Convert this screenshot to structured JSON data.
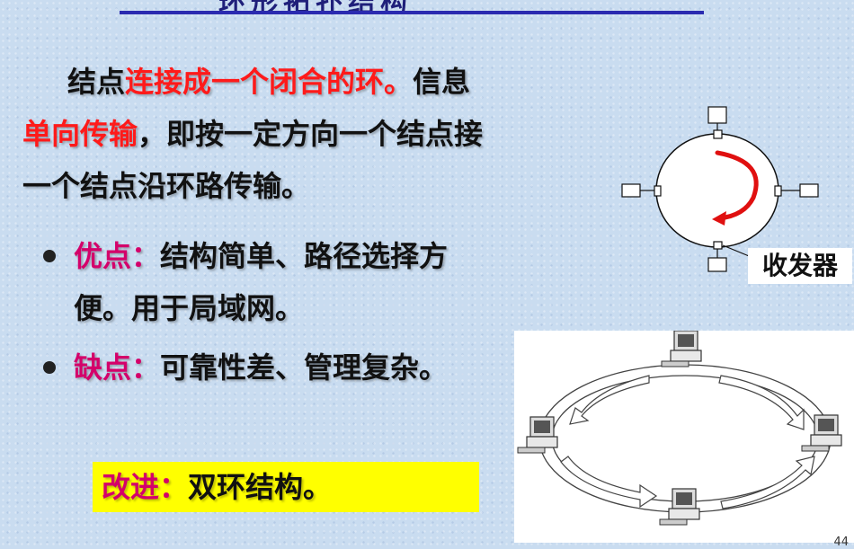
{
  "title": "环形拓扑结构",
  "paragraph": {
    "part1": "结点",
    "part2": "连接成一个闭合的环。",
    "part3": "信息",
    "part4": "单向传输",
    "part5": "，即按一定方向一个结点接",
    "part6": "一个结点沿环路传输。"
  },
  "advantages": {
    "label": "优点：",
    "line1": "结构简单、路径选择方",
    "line2": "便。用于局域网。"
  },
  "disadvantages": {
    "label": "缺点：",
    "text": "可靠性差、管理复杂。"
  },
  "improvement": {
    "label": "改进：",
    "text": "双环结构。"
  },
  "diagram": {
    "transceiver_label": "收发器",
    "arrow_color": "#e01010"
  },
  "page_number": "44"
}
